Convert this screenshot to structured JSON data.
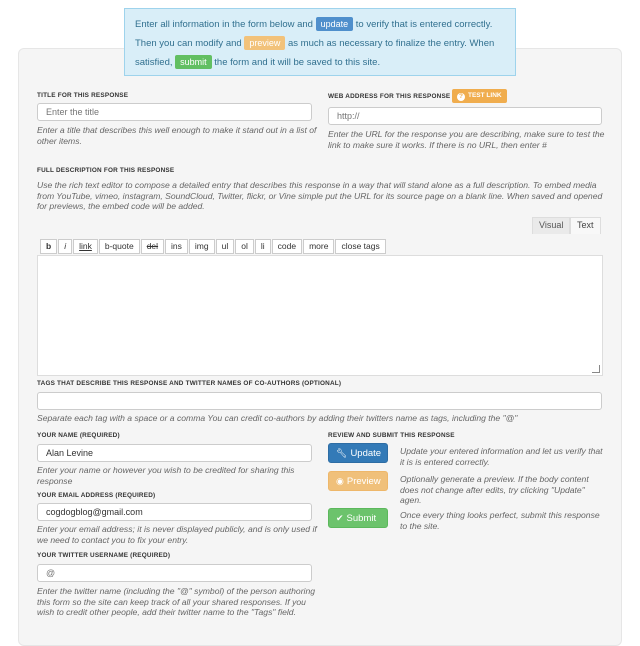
{
  "notice": {
    "t1": "Enter all information in the form below and",
    "update_chip": "update",
    "t2": "to verify that is entered correctly.",
    "t3": "Then you can modify and",
    "preview_chip": "preview",
    "t4": "as much as necessary to finalize the entry. When",
    "t5": "satisfied,",
    "submit_chip": "submit",
    "t6": "the form and it will be saved to this site."
  },
  "title_field": {
    "label": "TITLE FOR THIS RESPONSE",
    "placeholder": "Enter the title",
    "help": "Enter a title that describes this well enough to make it stand out in a list of other items."
  },
  "url_field": {
    "label": "WEB ADDRESS FOR THIS RESPONSE",
    "test_link": "TEST LINK",
    "test_icon": "?",
    "placeholder": "http://",
    "help": "Enter the URL for the response you are describing, make sure to test the link to make sure it works. If there is no URL, then enter #"
  },
  "description": {
    "label": "FULL DESCRIPTION FOR THIS RESPONSE",
    "help": "Use the rich text editor to compose a detailed entry that describes this response in a way that will stand alone as a full description. To embed media from YouTube, vimeo, instagram, SoundCloud, Twitter, flickr, or Vine simple put the URL for its source page on a blank line. When saved and opened for previews, the embed code will be added.",
    "tab_visual": "Visual",
    "tab_text": "Text",
    "toolbar": [
      "b",
      "i",
      "link",
      "b-quote",
      "del",
      "ins",
      "img",
      "ul",
      "ol",
      "li",
      "code",
      "more",
      "close tags"
    ]
  },
  "tags": {
    "label": "TAGS THAT DESCRIBE THIS RESPONSE AND TWITTER NAMES OF CO-AUTHORS (OPTIONAL)",
    "help": "Separate each tag with a space or a comma You can credit co-authors by adding their twitters name as tags, including the \"@\""
  },
  "name": {
    "label": "YOUR NAME (REQUIRED)",
    "value": "Alan Levine",
    "help": "Enter your name or however you wish to be credited for sharing this response"
  },
  "email": {
    "label": "YOUR EMAIL ADDRESS (REQUIRED)",
    "value": "cogdogblog@gmail.com",
    "help": "Enter your email address; it is never displayed publicly, and is only used if we need to contact you to fix your entry."
  },
  "twitter": {
    "label": "YOUR TWITTER USERNAME (REQUIRED)",
    "placeholder": "@",
    "help": "Enter the twitter name (including the \"@\" symbol) of the person authoring this form so the site can keep track of all your shared responses. If you wish to credit other people, add their twitter name to the \"Tags\" field."
  },
  "review": {
    "label": "REVIEW AND SUBMIT THIS RESPONSE",
    "update_label": "Update",
    "update_help": "Update your entered information and let us verify that it is is entered correctly.",
    "preview_label": "Preview",
    "preview_help": "Optionally generate a preview. If the body content does not change after edits, try clicking \"Update\" agen.",
    "submit_label": "Submit",
    "submit_help": "Once every thing looks perfect, submit this response to the site.",
    "update_icon": "wrench-icon",
    "preview_icon": "eye-icon",
    "submit_icon": "check-icon"
  },
  "colors": {
    "update": "#337ab7",
    "preview": "#f0c07a",
    "submit": "#6cc36c",
    "test_link": "#f0ad4e",
    "notice_bg": "#d9eef8"
  }
}
